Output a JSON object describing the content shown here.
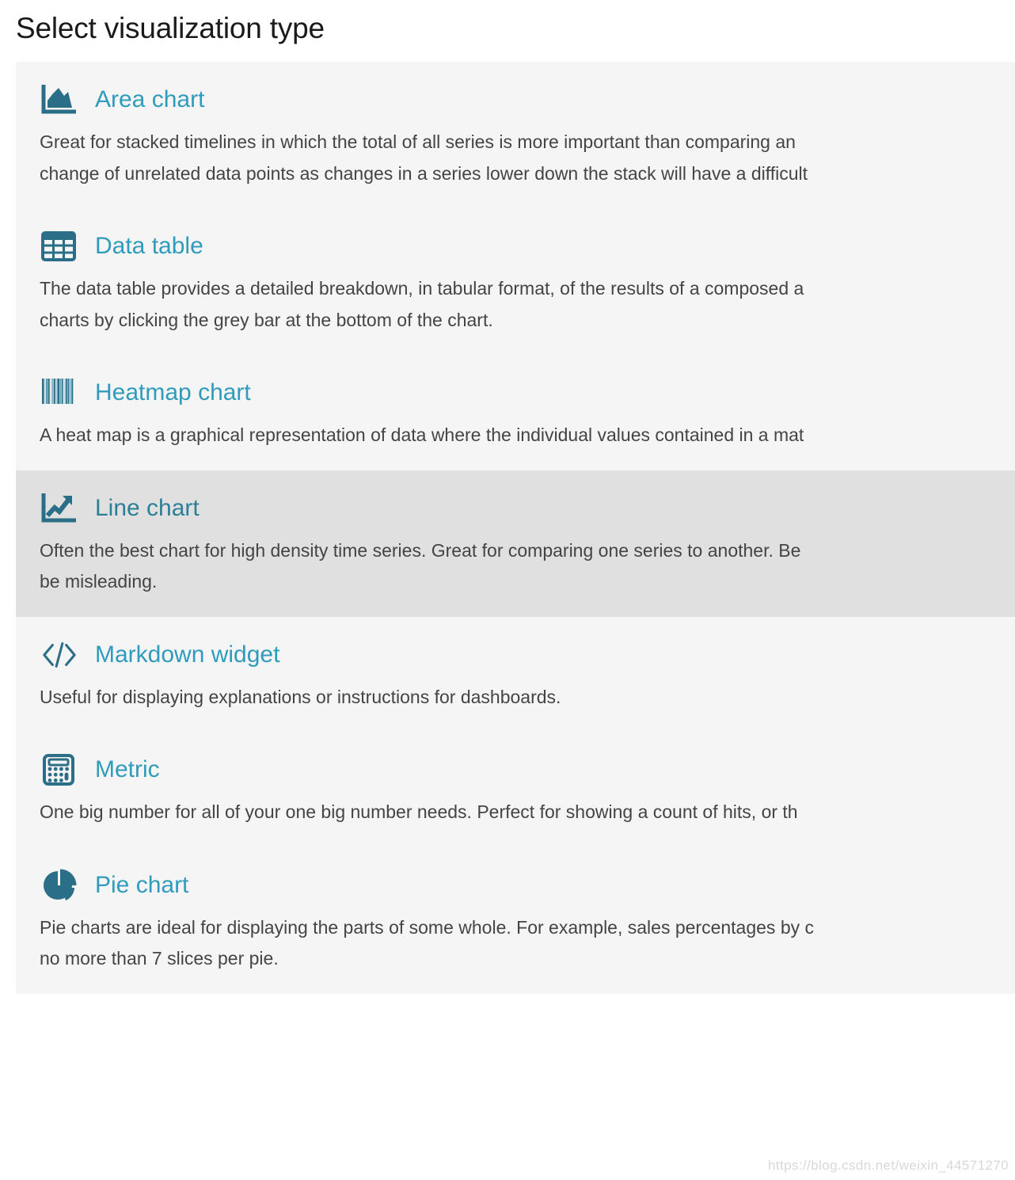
{
  "page": {
    "title": "Select visualization type"
  },
  "colors": {
    "panel_background": "#f5f5f5",
    "selected_background": "#e0e0e0",
    "link_title": "#2f9bbd",
    "icon": "#2b6e87",
    "description_text": "#444444",
    "heading_text": "#1a1a1a"
  },
  "watermark": {
    "text": "https://blog.csdn.net/weixin_44571270"
  },
  "items": [
    {
      "id": "area-chart",
      "icon": "area-chart-icon",
      "title": "Area chart",
      "selected": false,
      "description_lines": [
        "Great for stacked timelines in which the total of all series is more important than comparing an",
        "change of unrelated data points as changes in a series lower down the stack will have a difficult"
      ]
    },
    {
      "id": "data-table",
      "icon": "data-table-icon",
      "title": "Data table",
      "selected": false,
      "description_lines": [
        "The data table provides a detailed breakdown, in tabular format, of the results of a composed a",
        "charts by clicking the grey bar at the bottom of the chart."
      ]
    },
    {
      "id": "heatmap-chart",
      "icon": "heatmap-chart-icon",
      "title": "Heatmap chart",
      "selected": false,
      "description_lines": [
        "A heat map is a graphical representation of data where the individual values contained in a mat"
      ]
    },
    {
      "id": "line-chart",
      "icon": "line-chart-icon",
      "title": "Line chart",
      "selected": true,
      "description_lines": [
        "Often the best chart for high density time series. Great for comparing one series to another. Be",
        "be misleading."
      ]
    },
    {
      "id": "markdown-widget",
      "icon": "markdown-widget-icon",
      "title": "Markdown widget",
      "selected": false,
      "description_lines": [
        "Useful for displaying explanations or instructions for dashboards."
      ]
    },
    {
      "id": "metric",
      "icon": "metric-icon",
      "title": "Metric",
      "selected": false,
      "description_lines": [
        "One big number for all of your one big number needs. Perfect for showing a count of hits, or th"
      ]
    },
    {
      "id": "pie-chart",
      "icon": "pie-chart-icon",
      "title": "Pie chart",
      "selected": false,
      "description_lines": [
        "Pie charts are ideal for displaying the parts of some whole. For example, sales percentages by c",
        "no more than 7 slices per pie."
      ]
    }
  ]
}
